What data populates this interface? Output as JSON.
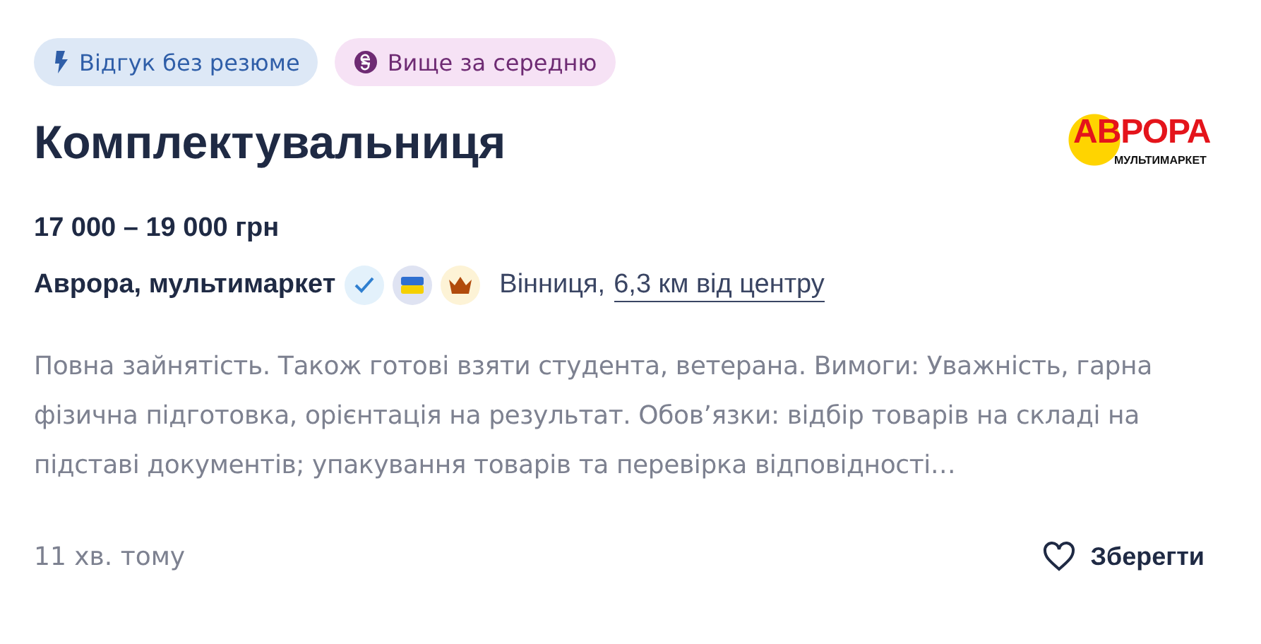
{
  "badges": [
    {
      "kind": "response",
      "label": "Відгук без резюме"
    },
    {
      "kind": "salary",
      "label": "Вище за середню"
    }
  ],
  "title": "Комплектувальниця",
  "logo": {
    "name": "АВРОРА",
    "tagline": "МУЛЬТИМАРКЕТ"
  },
  "salary": "17 000 – 19 000 грн",
  "company": {
    "name": "Аврора, мультимаркет",
    "verified": true,
    "ukraine_flag": true,
    "top_employer": true,
    "city": "Вінниця,",
    "distance": "6,3 км від центру"
  },
  "description": "Повна зайнятість. Також готові взяти студента, ветерана. Вимоги: Уважність, гарна фізична підготовка, орієнтація на результат. Обов’язки: відбір товарів на складі на підставі документів; упакування товарів та перевірка відповідності…",
  "posted": "11 хв. тому",
  "save_button": "Зберегти"
}
